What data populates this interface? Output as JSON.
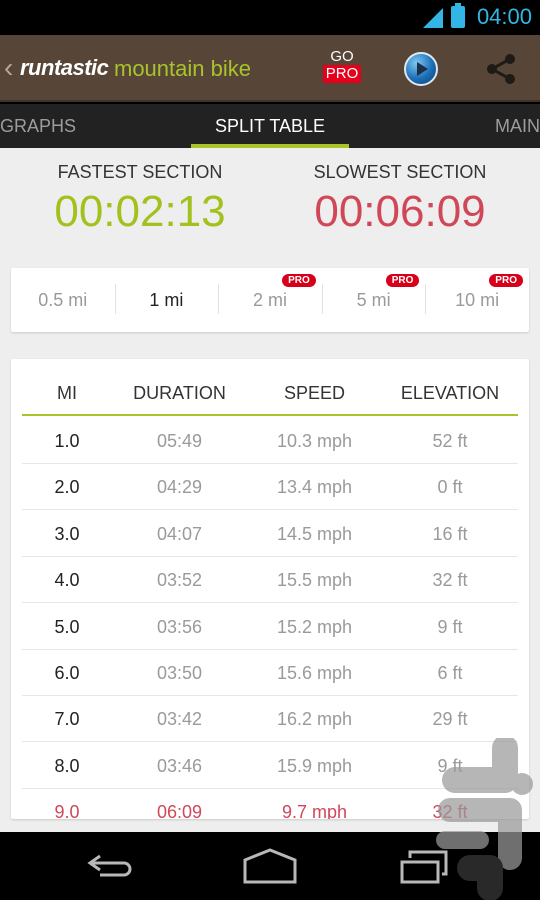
{
  "status_bar": {
    "time": "04:00"
  },
  "action_bar": {
    "brand": "runtastic",
    "subtitle": "mountain bike",
    "go_label": "GO",
    "pro_label": "PRO"
  },
  "tabs": [
    {
      "label": "GRAPHS"
    },
    {
      "label": "SPLIT TABLE",
      "active": true
    },
    {
      "label": "MAIN"
    }
  ],
  "summary": {
    "fastest_label": "FASTEST SECTION",
    "fastest_value": "00:02:13",
    "slowest_label": "SLOWEST SECTION",
    "slowest_value": "00:06:09",
    "fastest_color": "#a2c11c",
    "slowest_color": "#d04858"
  },
  "split_options": [
    {
      "label": "0.5 mi",
      "pro": false
    },
    {
      "label": "1 mi",
      "pro": false,
      "active": true
    },
    {
      "label": "2 mi",
      "pro": true
    },
    {
      "label": "5 mi",
      "pro": true
    },
    {
      "label": "10 mi",
      "pro": true
    }
  ],
  "pro_badge": "PRO",
  "table": {
    "headers": [
      "MI",
      "DURATION",
      "SPEED",
      "ELEVATION"
    ],
    "rows": [
      [
        "1.0",
        "05:49",
        "10.3 mph",
        "52 ft"
      ],
      [
        "2.0",
        "04:29",
        "13.4 mph",
        "0 ft"
      ],
      [
        "3.0",
        "04:07",
        "14.5 mph",
        "16 ft"
      ],
      [
        "4.0",
        "03:52",
        "15.5 mph",
        "32 ft"
      ],
      [
        "5.0",
        "03:56",
        "15.2 mph",
        "9 ft"
      ],
      [
        "6.0",
        "03:50",
        "15.6 mph",
        "6 ft"
      ],
      [
        "7.0",
        "03:42",
        "16.2 mph",
        "29 ft"
      ],
      [
        "8.0",
        "03:46",
        "15.9 mph",
        "9 ft"
      ],
      [
        "9.0",
        "06:09",
        "9.7 mph",
        "32 ft"
      ]
    ],
    "highlight_row": 8
  }
}
